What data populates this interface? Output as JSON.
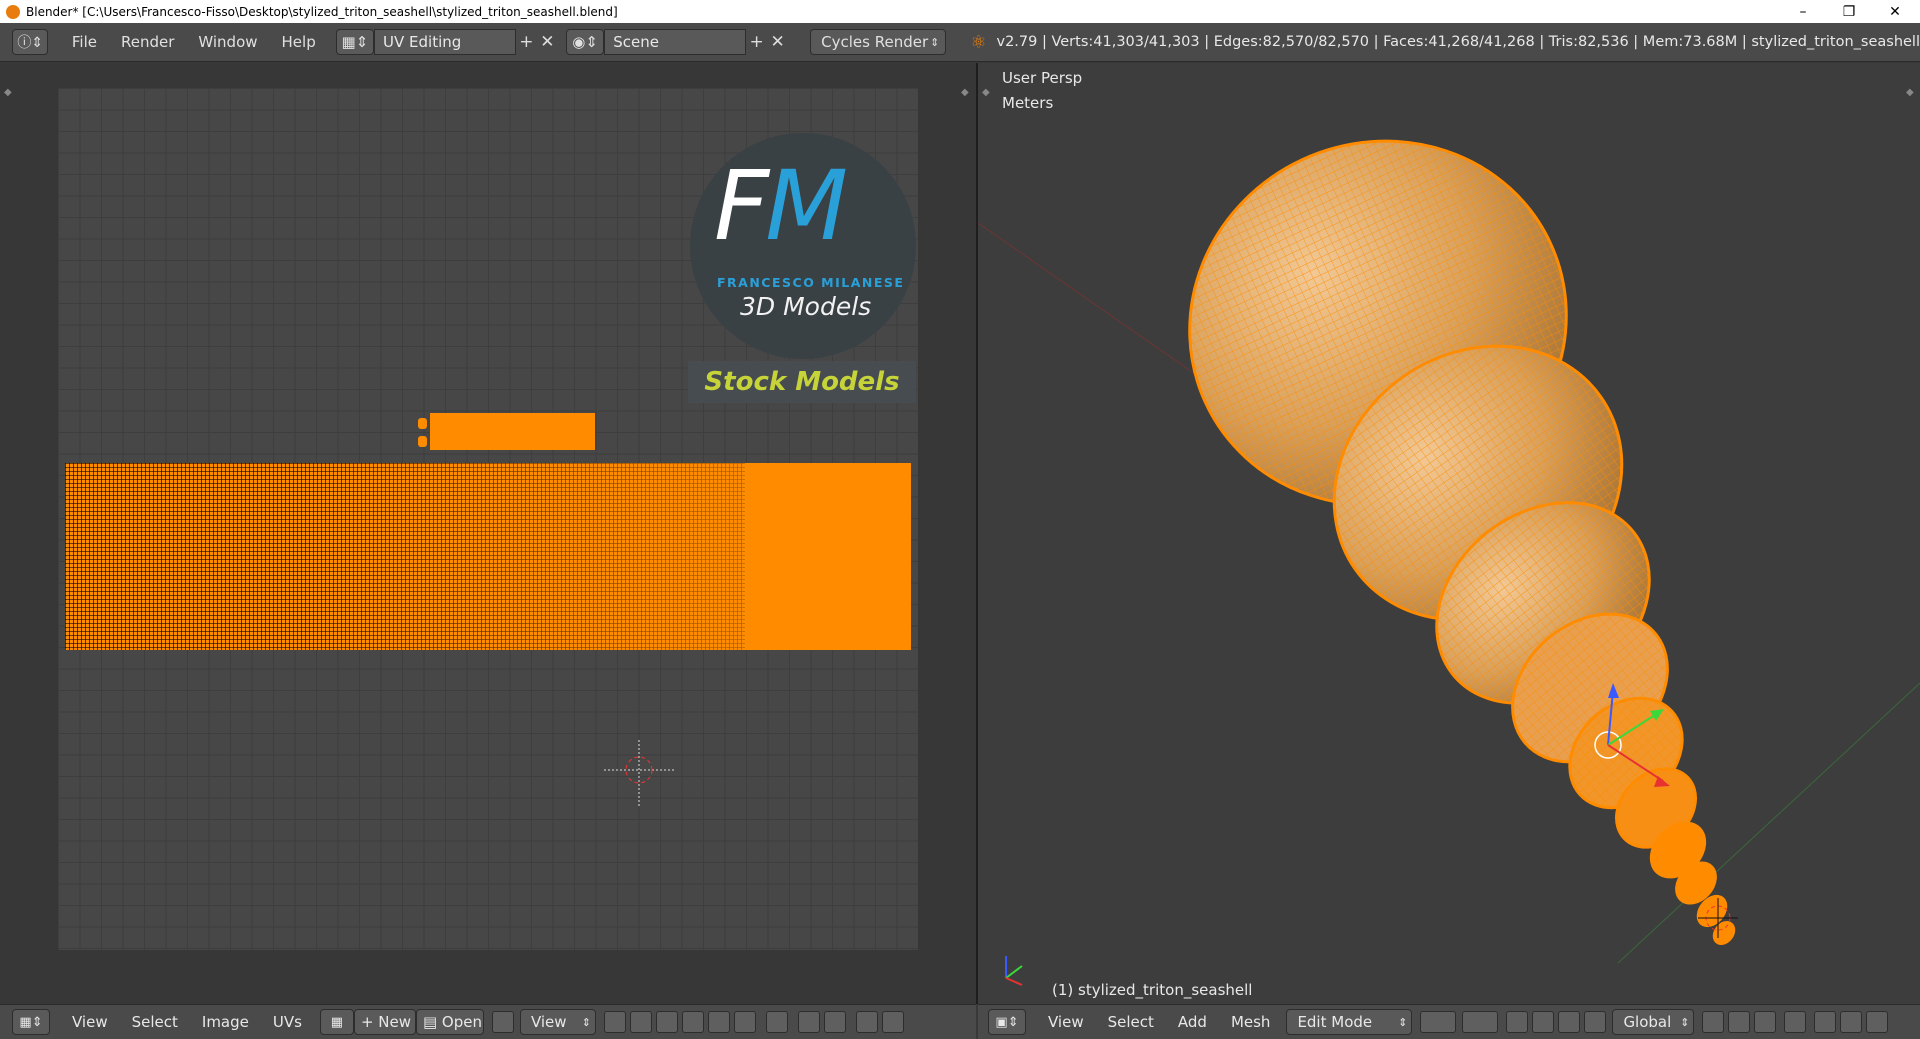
{
  "window": {
    "title": "Blender* [C:\\Users\\Francesco-Fisso\\Desktop\\stylized_triton_seashell\\stylized_triton_seashell.blend]"
  },
  "header": {
    "menus": [
      "File",
      "Render",
      "Window",
      "Help"
    ],
    "layout": "UV Editing",
    "scene": "Scene",
    "render_engine": "Cycles Render",
    "stats": "v2.79 | Verts:41,303/41,303 | Edges:82,570/82,570 | Faces:41,268/41,268 | Tris:82,536 | Mem:73.68M | stylized_triton_seashell"
  },
  "uv_editor": {
    "menus": [
      "View",
      "Select",
      "Image",
      "UVs"
    ],
    "new_label": "New",
    "open_label": "Open",
    "view_label": "View"
  },
  "viewport": {
    "perspective": "User Persp",
    "units": "Meters",
    "object_label": "(1) stylized_triton_seashell",
    "menus": [
      "View",
      "Select",
      "Add",
      "Mesh"
    ],
    "mode": "Edit Mode",
    "orientation": "Global"
  },
  "watermark": {
    "letters": "FM",
    "name": "FRANCESCO MILANESE",
    "subtitle": "3D Models",
    "badge": "Stock Models"
  },
  "colors": {
    "accent": "#ff8c00",
    "logo_blue": "#2aa0d8",
    "badge_text": "#c6d43a"
  }
}
